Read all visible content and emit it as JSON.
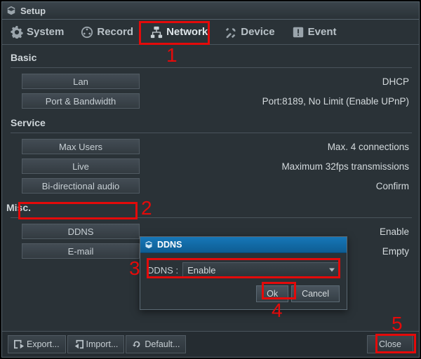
{
  "window_title": "Setup",
  "tabs": [
    {
      "label": "System"
    },
    {
      "label": "Record"
    },
    {
      "label": "Network"
    },
    {
      "label": "Device"
    },
    {
      "label": "Event"
    }
  ],
  "sections": {
    "basic": {
      "title": "Basic",
      "rows": [
        {
          "label": "Lan",
          "value": "DHCP"
        },
        {
          "label": "Port & Bandwidth",
          "value": "Port:8189, No Limit (Enable UPnP)"
        }
      ]
    },
    "service": {
      "title": "Service",
      "rows": [
        {
          "label": "Max Users",
          "value": "Max. 4 connections"
        },
        {
          "label": "Live",
          "value": "Maximum 32fps transmissions"
        },
        {
          "label": "Bi-directional audio",
          "value": "Confirm"
        }
      ]
    },
    "misc": {
      "title": "Misc.",
      "rows": [
        {
          "label": "DDNS",
          "value": "Enable"
        },
        {
          "label": "E-mail",
          "value": "Empty"
        }
      ]
    }
  },
  "popup": {
    "title": "DDNS",
    "field_label": "DDNS :",
    "selected": "Enable",
    "ok": "Ok",
    "cancel": "Cancel"
  },
  "footer": {
    "export": "Export...",
    "import": "Import...",
    "default": "Default...",
    "close": "Close"
  },
  "annotations": {
    "n1": "1",
    "n2": "2",
    "n3": "3",
    "n4": "4",
    "n5": "5"
  }
}
